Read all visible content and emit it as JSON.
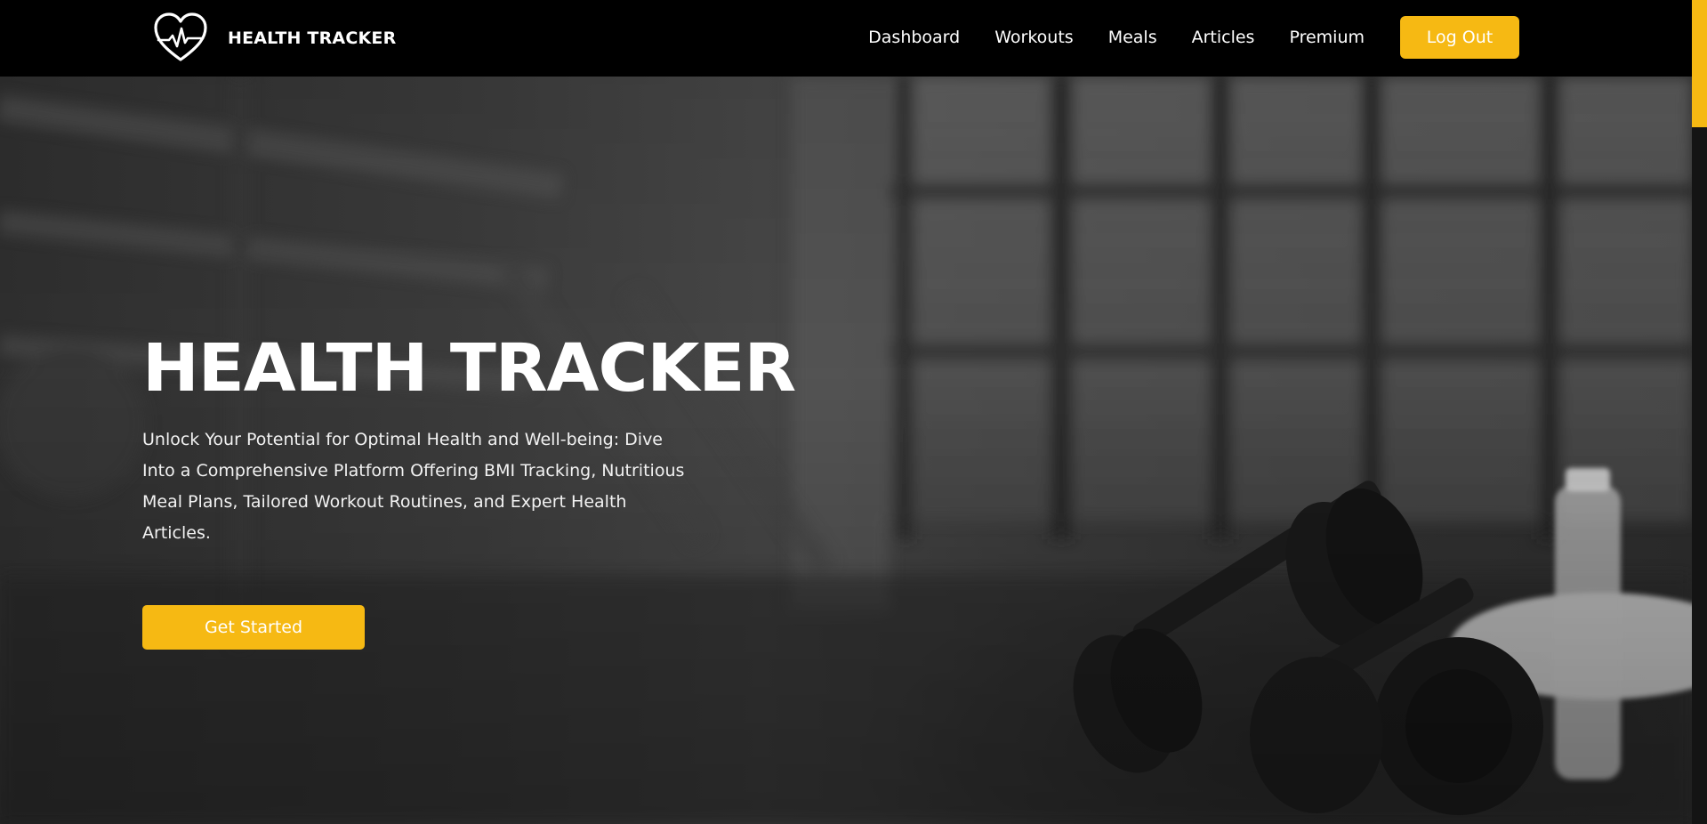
{
  "brand": {
    "name": "HEALTH TRACKER",
    "logo_icon": "heart-pulse-icon"
  },
  "nav": {
    "links": [
      "Dashboard",
      "Workouts",
      "Meals",
      "Articles",
      "Premium"
    ],
    "logout_label": "Log Out"
  },
  "hero": {
    "title": "HEALTH TRACKER",
    "subtitle": "Unlock Your Potential for Optimal Health and Well-being: Dive Into a Comprehensive Platform Offering BMI Tracking, Nutritious Meal Plans, Tailored Workout Routines, and Expert Health Articles.",
    "cta_label": "Get Started"
  },
  "colors": {
    "accent": "#f6b913",
    "nav_background": "#000000",
    "text": "#ffffff"
  }
}
